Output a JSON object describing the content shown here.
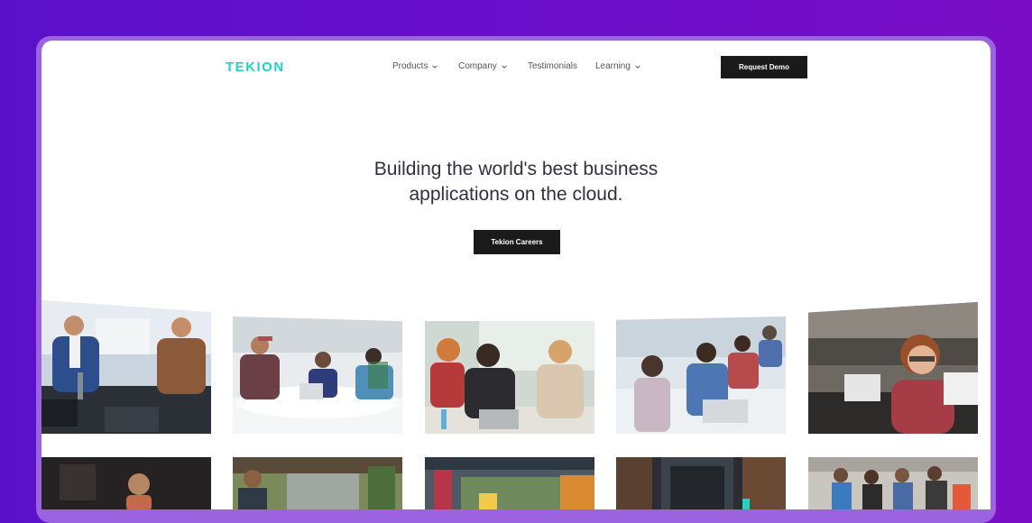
{
  "brand": {
    "logo_text": "TEKION",
    "logo_color": "#22d3c5"
  },
  "nav": {
    "items": [
      {
        "label": "Products",
        "has_dropdown": true
      },
      {
        "label": "Company",
        "has_dropdown": true
      },
      {
        "label": "Testimonials",
        "has_dropdown": false
      },
      {
        "label": "Learning",
        "has_dropdown": true
      }
    ],
    "cta_label": "Request Demo"
  },
  "hero": {
    "line1": "Building the world's best  business",
    "line2": "applications on the cloud.",
    "cta_label": "Tekion Careers"
  },
  "gallery": {
    "row1": [
      {
        "subject": "two men in suits at laptop meeting"
      },
      {
        "subject": "team meeting around white table"
      },
      {
        "subject": "women in discussion with laptop"
      },
      {
        "subject": "people working at desks in office"
      },
      {
        "subject": "woman with glasses at monitor"
      }
    ],
    "row2": [
      {
        "subject": "woman on stage with dark backdrop"
      },
      {
        "subject": "people outdoors under pergola"
      },
      {
        "subject": "colorful outdoor venue"
      },
      {
        "subject": "building entrance"
      },
      {
        "subject": "group of people standing"
      }
    ]
  },
  "colors": {
    "background": "#6a0fcb",
    "frame": "#9b63e0",
    "button": "#1a1a1a"
  }
}
